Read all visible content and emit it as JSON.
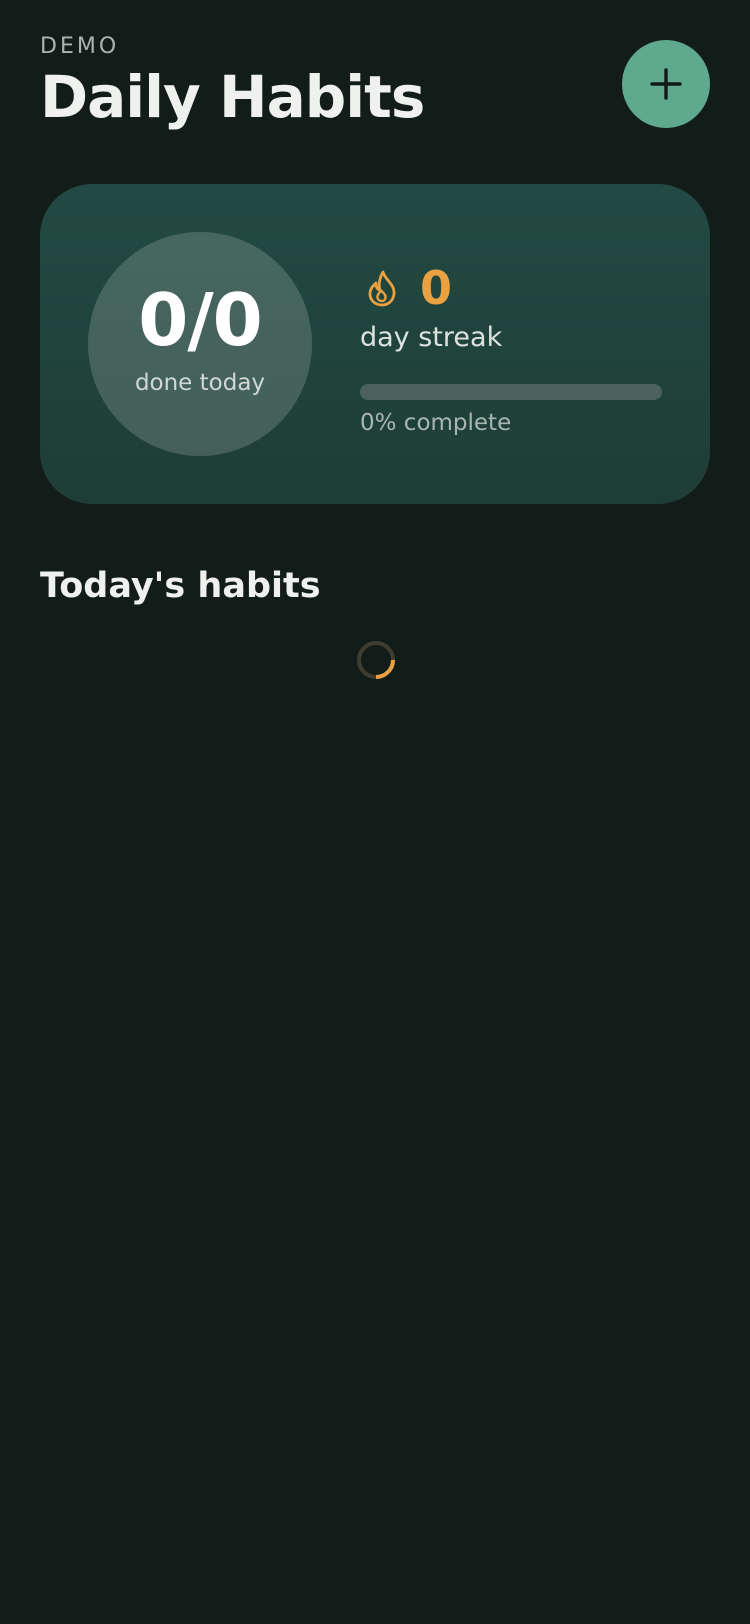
{
  "header": {
    "eyebrow": "DEMO",
    "title": "Daily Habits",
    "add_icon": "plus-icon"
  },
  "summary": {
    "done_count": "0/0",
    "done_label": "done today",
    "streak_icon": "flame-icon",
    "streak_count": "0",
    "streak_label": "day streak",
    "progress_percent": 0,
    "progress_label": "0% complete"
  },
  "habits": {
    "section_title": "Today's habits",
    "loading_icon": "spinner-icon",
    "items": []
  },
  "colors": {
    "background": "#121c19",
    "accent_green": "#5fa98f",
    "card": "#224a42",
    "streak_orange": "#eaa142"
  }
}
